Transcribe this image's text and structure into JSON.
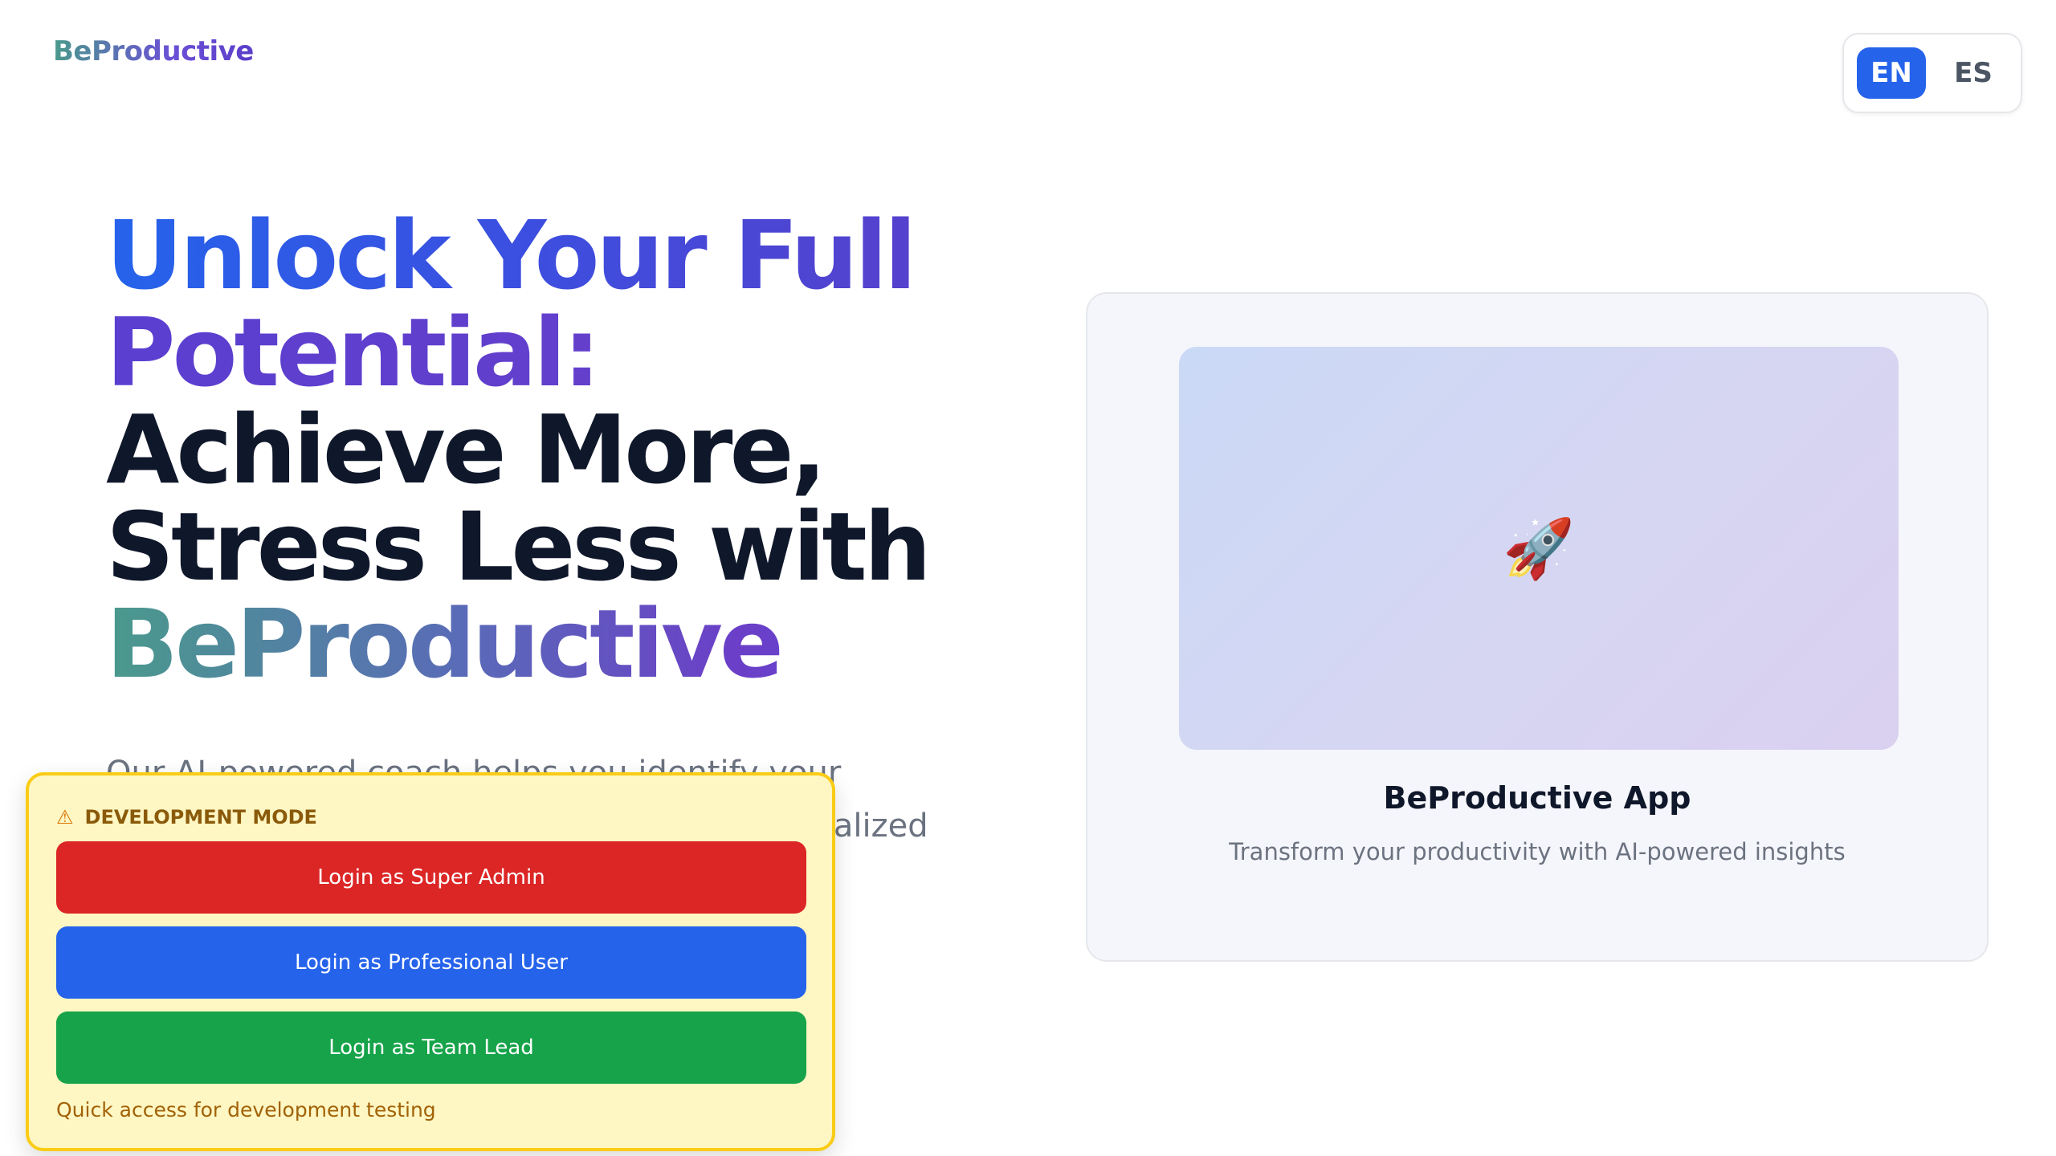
{
  "brand": {
    "logo_text": "BeProductive"
  },
  "language_switch": {
    "options": [
      "EN",
      "ES"
    ],
    "selected": "EN"
  },
  "hero": {
    "title_line1": "Unlock Your Full",
    "title_line2": "Potential:",
    "title_line3": "Achieve More,",
    "title_line4": "Stress Less with",
    "title_line5": "BeProductive",
    "subtitle": "Our AI-powered coach helps you identify your unique productivity style and delivers personalized"
  },
  "preview": {
    "icon": "rocket-icon",
    "title": "BeProductive App",
    "description": "Transform your productivity with AI-powered insights"
  },
  "dev_panel": {
    "header": "DEVELOPMENT MODE",
    "header_icon": "warning-icon",
    "buttons": {
      "super_admin": "Login as Super Admin",
      "professional": "Login as Professional User",
      "team_lead": "Login as Team Lead"
    },
    "note": "Quick access for development testing"
  },
  "colors": {
    "primary_blue": "#2563eb",
    "danger_red": "#dc2626",
    "success_green": "#16a34a",
    "warning_bg": "#fef6c3",
    "warning_border": "#facc15"
  }
}
